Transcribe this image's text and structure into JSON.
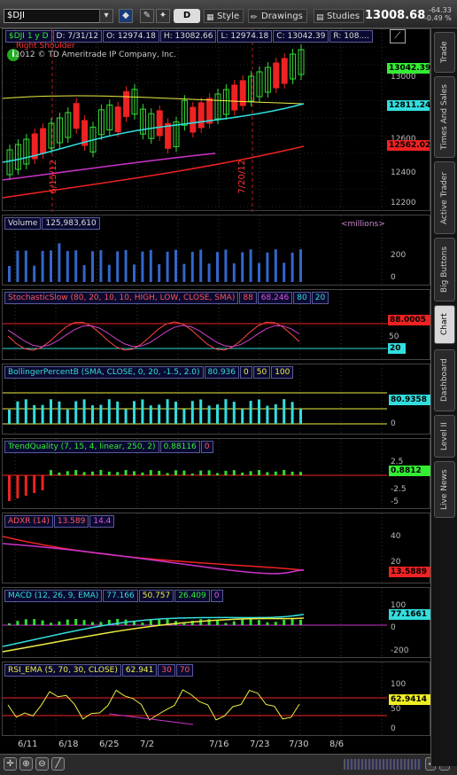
{
  "toolbar": {
    "symbol": "$DJI",
    "aggregation": "D",
    "style_label": "Style",
    "drawings_label": "Drawings",
    "studies_label": "Studies",
    "last_price": "13008.68",
    "net_change": "-64.33",
    "pct_change": "-0.49 %"
  },
  "price_header": {
    "symbol_period": "$DJI 1 y D",
    "date": "D: 7/31/12",
    "open": "O: 12974.18",
    "high": "H: 13082.66",
    "low": "L: 12974.18",
    "close": "C: 13042.39",
    "range": "R: 108...."
  },
  "watermark": "2012 © TD Ameritrade IP Company, Inc.",
  "pattern_label": "Right Shoulder",
  "vertical_labels": [
    "6/15/12",
    "7/20/12"
  ],
  "price_axis": {
    "ticks": [
      "13000",
      "12800",
      "12600",
      "12400",
      "12200"
    ],
    "badges": [
      {
        "value": "13042.39",
        "color": "#33ee33"
      },
      {
        "value": "12811.24",
        "color": "#33dddd"
      },
      {
        "value": "12562.02",
        "color": "#ee2222"
      }
    ]
  },
  "volume": {
    "label": "Volume",
    "value": "125,983,610",
    "units": "<millions>",
    "ticks": [
      "200",
      "0"
    ]
  },
  "stochastic": {
    "label": "StochasticSlow (80, 20, 10, 10, HIGH, LOW, CLOSE, SMA)",
    "v1": "88",
    "v2": "68.246",
    "v3": "80",
    "v4": "20",
    "ticks": [
      "50"
    ],
    "badges": [
      {
        "value": "88.0005",
        "color": "#ee2222"
      },
      {
        "value": "20",
        "color": "#33dddd"
      }
    ]
  },
  "bollinger": {
    "label": "BollingerPercentB (SMA, CLOSE, 0, 20, -1.5, 2.0)",
    "v1": "80.936",
    "v2": "0",
    "v3": "50",
    "v4": "100",
    "ticks": [
      "0"
    ],
    "badge": {
      "value": "80.9358",
      "color": "#33dddd"
    }
  },
  "trend_quality": {
    "label": "TrendQuality (7, 15, 4, linear, 250, 2)",
    "v1": "0.88116",
    "v2": "0",
    "ticks": [
      "2.5",
      "-2.5",
      "-5"
    ],
    "badge": {
      "value": "0.8812",
      "color": "#33ee33"
    }
  },
  "adxr": {
    "label": "ADXR (14)",
    "v1": "13.589",
    "v2": "14.4",
    "ticks": [
      "40",
      "20"
    ],
    "badge": {
      "value": "13.5889",
      "color": "#ee2222"
    }
  },
  "macd": {
    "label": "MACD (12, 26, 9, EMA)",
    "v1": "77.166",
    "v2": "50.757",
    "v3": "26.409",
    "v4": "0",
    "ticks": [
      "100",
      "0",
      "-200"
    ],
    "badge": {
      "value": "77.1661",
      "color": "#33dddd"
    }
  },
  "rsi": {
    "label": "RSI_EMA (5, 70, 30, CLOSE)",
    "v1": "62.941",
    "v2": "30",
    "v3": "70",
    "ticks": [
      "100",
      "50",
      "0"
    ],
    "badge": {
      "value": "62.9414",
      "color": "#eeee22"
    }
  },
  "x_axis": [
    "6/11",
    "6/18",
    "6/25",
    "7/2",
    "7/16",
    "7/23",
    "7/30",
    "8/6"
  ],
  "side_tabs": [
    "Trade",
    "Times And Sales",
    "Active Trader",
    "Big Buttons",
    "Chart",
    "Dashboard",
    "Level II",
    "Live News"
  ],
  "active_tab": "Chart",
  "colors": {
    "up": "#33dd33",
    "down": "#ee2222",
    "cyan": "#33dddd",
    "magenta": "#cc33cc",
    "yellow": "#eeee44"
  }
}
